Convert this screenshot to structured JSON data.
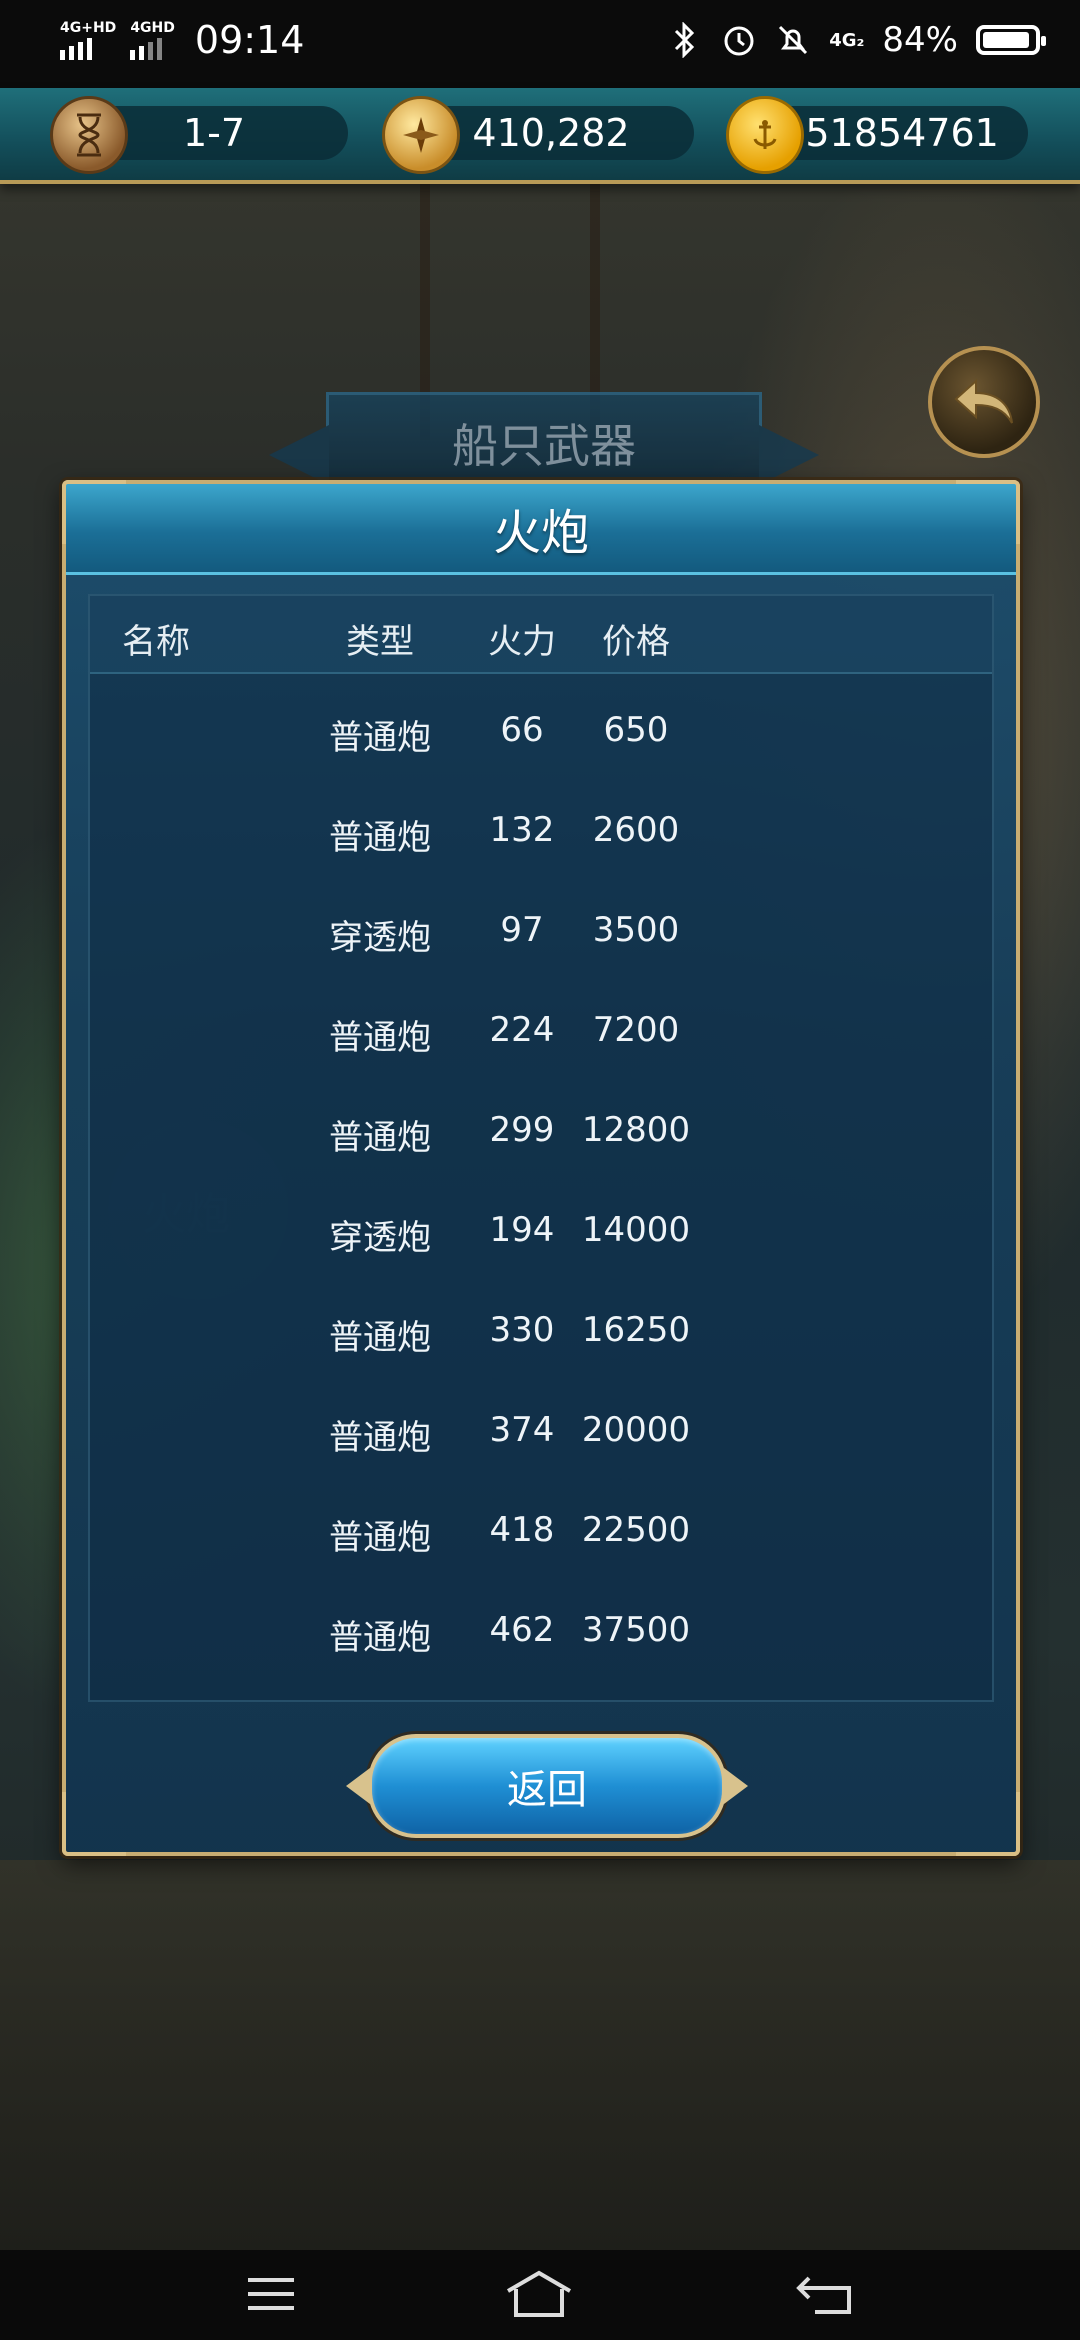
{
  "status_bar": {
    "network1": "4G+HD",
    "network2": "4GHD",
    "time": "09:14",
    "signal_extra": "4G₂",
    "battery": "84%",
    "icons": [
      "bluetooth-icon",
      "alarm-icon",
      "mute-icon",
      "signal-icon",
      "battery-icon"
    ]
  },
  "resources": {
    "level": "1-7",
    "compass_value": "410,282",
    "gold": "151854761",
    "icons": [
      "hourglass-icon",
      "compass-icon",
      "gold-coin-icon"
    ]
  },
  "background": {
    "banner_title": "船只武器",
    "faded_label": "火炮"
  },
  "dialog": {
    "title": "火炮",
    "columns": [
      "名称",
      "类型",
      "火力",
      "价格"
    ],
    "rows": [
      {
        "name": "",
        "type": "普通炮",
        "firepower": "66",
        "price": "650"
      },
      {
        "name": "",
        "type": "普通炮",
        "firepower": "132",
        "price": "2600"
      },
      {
        "name": "",
        "type": "穿透炮",
        "firepower": "97",
        "price": "3500"
      },
      {
        "name": "",
        "type": "普通炮",
        "firepower": "224",
        "price": "7200"
      },
      {
        "name": "",
        "type": "普通炮",
        "firepower": "299",
        "price": "12800"
      },
      {
        "name": "",
        "type": "穿透炮",
        "firepower": "194",
        "price": "14000"
      },
      {
        "name": "",
        "type": "普通炮",
        "firepower": "330",
        "price": "16250"
      },
      {
        "name": "",
        "type": "普通炮",
        "firepower": "374",
        "price": "20000"
      },
      {
        "name": "",
        "type": "普通炮",
        "firepower": "418",
        "price": "22500"
      },
      {
        "name": "",
        "type": "普通炮",
        "firepower": "462",
        "price": "37500"
      }
    ],
    "return_label": "返回"
  },
  "colors": {
    "accent_gold": "#c8ad72",
    "dialog_blue": "#1b4f70",
    "button_blue": "#1f8fd4"
  },
  "nav": [
    "menu-icon",
    "home-icon",
    "back-icon"
  ]
}
